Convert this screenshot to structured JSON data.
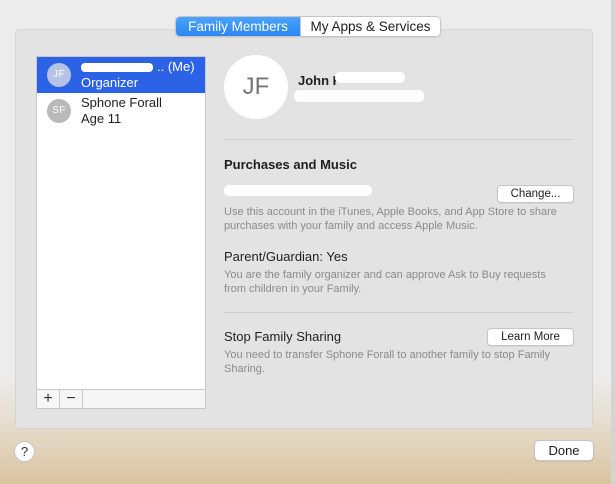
{
  "tabs": [
    {
      "label": "Family Members",
      "active": true
    },
    {
      "label": "My Apps & Services",
      "active": false
    }
  ],
  "members": [
    {
      "initials": "JF",
      "name_suffix": ".. (Me)",
      "role": "Organizer",
      "selected": true
    },
    {
      "initials": "SF",
      "name": "Sphone Forall",
      "role": "Age 11",
      "selected": false
    }
  ],
  "list_controls": {
    "add": "+",
    "remove": "−"
  },
  "detail": {
    "avatar_initials": "JF",
    "name": "John F",
    "purchases": {
      "heading": "Purchases and Music",
      "change_button": "Change...",
      "description": "Use this account in the iTunes, Apple Books, and App Store to share purchases with your family and access Apple Music."
    },
    "guardian": {
      "title": "Parent/Guardian: Yes",
      "description": "You are the family organizer and can approve Ask to Buy requests from children in your Family."
    },
    "stop_sharing": {
      "title": "Stop Family Sharing",
      "button": "Learn More",
      "description": "You need to transfer Sphone Forall to another family to stop Family Sharing."
    }
  },
  "footer": {
    "help": "?",
    "done": "Done"
  },
  "colors": {
    "accent": "#2a86f4",
    "selection": "#2c63e6"
  }
}
